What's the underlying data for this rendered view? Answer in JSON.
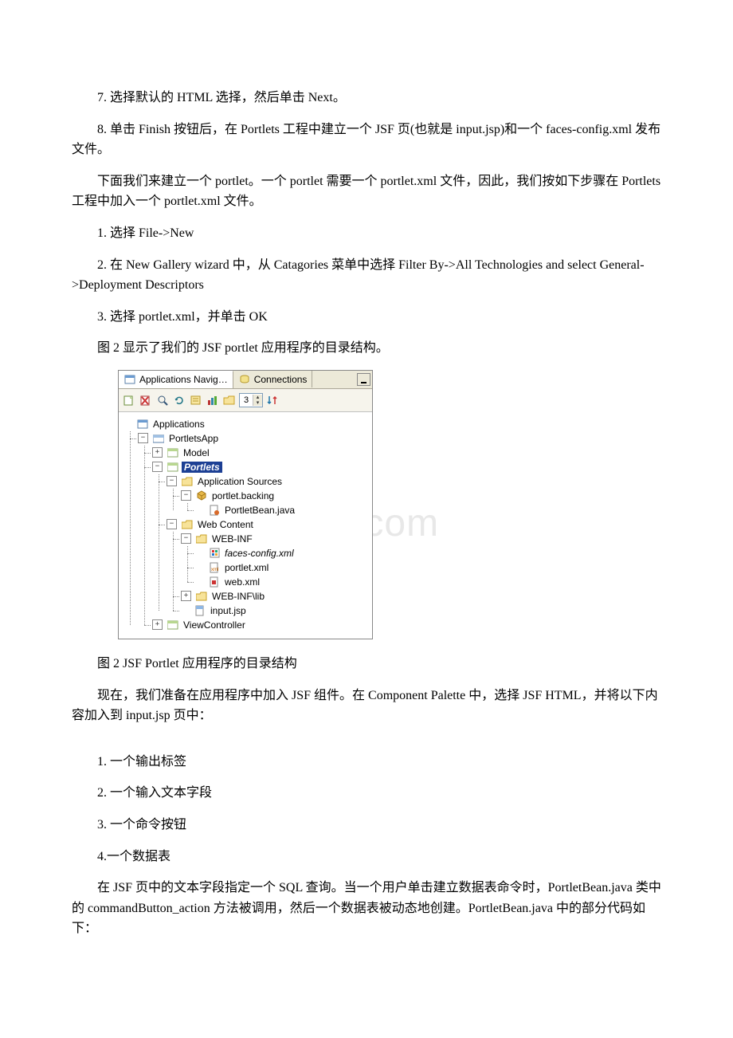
{
  "paragraphs": {
    "p1": "7. 选择默认的 HTML 选择，然后单击 Next。",
    "p2": "8. 单击 Finish 按钮后，在 Portlets 工程中建立一个 JSF 页(也就是 input.jsp)和一个 faces-config.xml 发布文件。",
    "p3": "下面我们来建立一个 portlet。一个 portlet 需要一个 portlet.xml 文件，因此，我们按如下步骤在 Portlets 工程中加入一个 portlet.xml 文件。",
    "p4": "1. 选择 File->New",
    "p5": "2. 在 New Gallery wizard 中，从 Catagories 菜单中选择 Filter By->All Technologies and select General->Deployment Descriptors",
    "p6": "3. 选择 portlet.xml，并单击 OK",
    "p7": "图 2 显示了我们的 JSF portlet 应用程序的目录结构。",
    "figcap": "图 2 JSF Portlet 应用程序的目录结构",
    "p8": "现在，我们准备在应用程序中加入 JSF 组件。在 Component Palette 中，选择 JSF HTML，并将以下内容加入到 input.jsp 页中：",
    "l1": "1. 一个输出标签",
    "l2": "2. 一个输入文本字段",
    "l3": "3. 一个命令按钮",
    "l4": "4.一个数据表",
    "p9": "在 JSF 页中的文本字段指定一个 SQL 查询。当一个用户单击建立数据表命令时，PortletBean.java 类中的 commandButton_action 方法被调用，然后一个数据表被动态地创建。PortletBean.java 中的部分代码如下："
  },
  "navigator": {
    "tab_active": "Applications Navig…",
    "tab_inactive": "Connections",
    "toolbar_number": "3",
    "tree": {
      "root": "Applications",
      "app": "PortletsApp",
      "model": "Model",
      "portlets": "Portlets",
      "appsrc": "Application Sources",
      "backing": "portlet.backing",
      "bean": "PortletBean.java",
      "webcontent": "Web Content",
      "webinf": "WEB-INF",
      "faces": "faces-config.xml",
      "portletxml": "portlet.xml",
      "webxml": "web.xml",
      "webinflib": "WEB-INF\\lib",
      "inputjsp": "input.jsp",
      "viewctrl": "ViewController"
    }
  },
  "watermark": "bdocx.com"
}
